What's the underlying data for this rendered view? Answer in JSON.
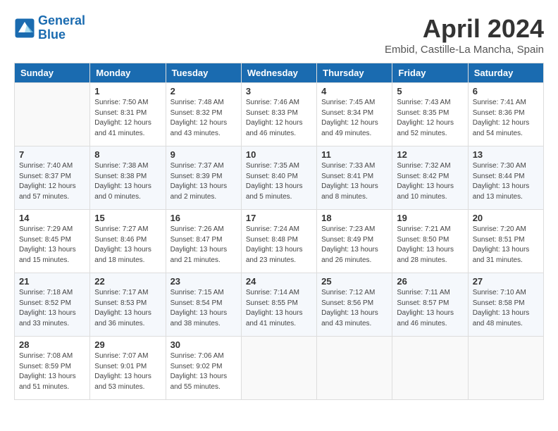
{
  "header": {
    "logo_line1": "General",
    "logo_line2": "Blue",
    "month": "April 2024",
    "location": "Embid, Castille-La Mancha, Spain"
  },
  "weekdays": [
    "Sunday",
    "Monday",
    "Tuesday",
    "Wednesday",
    "Thursday",
    "Friday",
    "Saturday"
  ],
  "weeks": [
    [
      {
        "num": "",
        "sunrise": "",
        "sunset": "",
        "daylight": ""
      },
      {
        "num": "1",
        "sunrise": "Sunrise: 7:50 AM",
        "sunset": "Sunset: 8:31 PM",
        "daylight": "Daylight: 12 hours and 41 minutes."
      },
      {
        "num": "2",
        "sunrise": "Sunrise: 7:48 AM",
        "sunset": "Sunset: 8:32 PM",
        "daylight": "Daylight: 12 hours and 43 minutes."
      },
      {
        "num": "3",
        "sunrise": "Sunrise: 7:46 AM",
        "sunset": "Sunset: 8:33 PM",
        "daylight": "Daylight: 12 hours and 46 minutes."
      },
      {
        "num": "4",
        "sunrise": "Sunrise: 7:45 AM",
        "sunset": "Sunset: 8:34 PM",
        "daylight": "Daylight: 12 hours and 49 minutes."
      },
      {
        "num": "5",
        "sunrise": "Sunrise: 7:43 AM",
        "sunset": "Sunset: 8:35 PM",
        "daylight": "Daylight: 12 hours and 52 minutes."
      },
      {
        "num": "6",
        "sunrise": "Sunrise: 7:41 AM",
        "sunset": "Sunset: 8:36 PM",
        "daylight": "Daylight: 12 hours and 54 minutes."
      }
    ],
    [
      {
        "num": "7",
        "sunrise": "Sunrise: 7:40 AM",
        "sunset": "Sunset: 8:37 PM",
        "daylight": "Daylight: 12 hours and 57 minutes."
      },
      {
        "num": "8",
        "sunrise": "Sunrise: 7:38 AM",
        "sunset": "Sunset: 8:38 PM",
        "daylight": "Daylight: 13 hours and 0 minutes."
      },
      {
        "num": "9",
        "sunrise": "Sunrise: 7:37 AM",
        "sunset": "Sunset: 8:39 PM",
        "daylight": "Daylight: 13 hours and 2 minutes."
      },
      {
        "num": "10",
        "sunrise": "Sunrise: 7:35 AM",
        "sunset": "Sunset: 8:40 PM",
        "daylight": "Daylight: 13 hours and 5 minutes."
      },
      {
        "num": "11",
        "sunrise": "Sunrise: 7:33 AM",
        "sunset": "Sunset: 8:41 PM",
        "daylight": "Daylight: 13 hours and 8 minutes."
      },
      {
        "num": "12",
        "sunrise": "Sunrise: 7:32 AM",
        "sunset": "Sunset: 8:42 PM",
        "daylight": "Daylight: 13 hours and 10 minutes."
      },
      {
        "num": "13",
        "sunrise": "Sunrise: 7:30 AM",
        "sunset": "Sunset: 8:44 PM",
        "daylight": "Daylight: 13 hours and 13 minutes."
      }
    ],
    [
      {
        "num": "14",
        "sunrise": "Sunrise: 7:29 AM",
        "sunset": "Sunset: 8:45 PM",
        "daylight": "Daylight: 13 hours and 15 minutes."
      },
      {
        "num": "15",
        "sunrise": "Sunrise: 7:27 AM",
        "sunset": "Sunset: 8:46 PM",
        "daylight": "Daylight: 13 hours and 18 minutes."
      },
      {
        "num": "16",
        "sunrise": "Sunrise: 7:26 AM",
        "sunset": "Sunset: 8:47 PM",
        "daylight": "Daylight: 13 hours and 21 minutes."
      },
      {
        "num": "17",
        "sunrise": "Sunrise: 7:24 AM",
        "sunset": "Sunset: 8:48 PM",
        "daylight": "Daylight: 13 hours and 23 minutes."
      },
      {
        "num": "18",
        "sunrise": "Sunrise: 7:23 AM",
        "sunset": "Sunset: 8:49 PM",
        "daylight": "Daylight: 13 hours and 26 minutes."
      },
      {
        "num": "19",
        "sunrise": "Sunrise: 7:21 AM",
        "sunset": "Sunset: 8:50 PM",
        "daylight": "Daylight: 13 hours and 28 minutes."
      },
      {
        "num": "20",
        "sunrise": "Sunrise: 7:20 AM",
        "sunset": "Sunset: 8:51 PM",
        "daylight": "Daylight: 13 hours and 31 minutes."
      }
    ],
    [
      {
        "num": "21",
        "sunrise": "Sunrise: 7:18 AM",
        "sunset": "Sunset: 8:52 PM",
        "daylight": "Daylight: 13 hours and 33 minutes."
      },
      {
        "num": "22",
        "sunrise": "Sunrise: 7:17 AM",
        "sunset": "Sunset: 8:53 PM",
        "daylight": "Daylight: 13 hours and 36 minutes."
      },
      {
        "num": "23",
        "sunrise": "Sunrise: 7:15 AM",
        "sunset": "Sunset: 8:54 PM",
        "daylight": "Daylight: 13 hours and 38 minutes."
      },
      {
        "num": "24",
        "sunrise": "Sunrise: 7:14 AM",
        "sunset": "Sunset: 8:55 PM",
        "daylight": "Daylight: 13 hours and 41 minutes."
      },
      {
        "num": "25",
        "sunrise": "Sunrise: 7:12 AM",
        "sunset": "Sunset: 8:56 PM",
        "daylight": "Daylight: 13 hours and 43 minutes."
      },
      {
        "num": "26",
        "sunrise": "Sunrise: 7:11 AM",
        "sunset": "Sunset: 8:57 PM",
        "daylight": "Daylight: 13 hours and 46 minutes."
      },
      {
        "num": "27",
        "sunrise": "Sunrise: 7:10 AM",
        "sunset": "Sunset: 8:58 PM",
        "daylight": "Daylight: 13 hours and 48 minutes."
      }
    ],
    [
      {
        "num": "28",
        "sunrise": "Sunrise: 7:08 AM",
        "sunset": "Sunset: 8:59 PM",
        "daylight": "Daylight: 13 hours and 51 minutes."
      },
      {
        "num": "29",
        "sunrise": "Sunrise: 7:07 AM",
        "sunset": "Sunset: 9:01 PM",
        "daylight": "Daylight: 13 hours and 53 minutes."
      },
      {
        "num": "30",
        "sunrise": "Sunrise: 7:06 AM",
        "sunset": "Sunset: 9:02 PM",
        "daylight": "Daylight: 13 hours and 55 minutes."
      },
      {
        "num": "",
        "sunrise": "",
        "sunset": "",
        "daylight": ""
      },
      {
        "num": "",
        "sunrise": "",
        "sunset": "",
        "daylight": ""
      },
      {
        "num": "",
        "sunrise": "",
        "sunset": "",
        "daylight": ""
      },
      {
        "num": "",
        "sunrise": "",
        "sunset": "",
        "daylight": ""
      }
    ]
  ]
}
